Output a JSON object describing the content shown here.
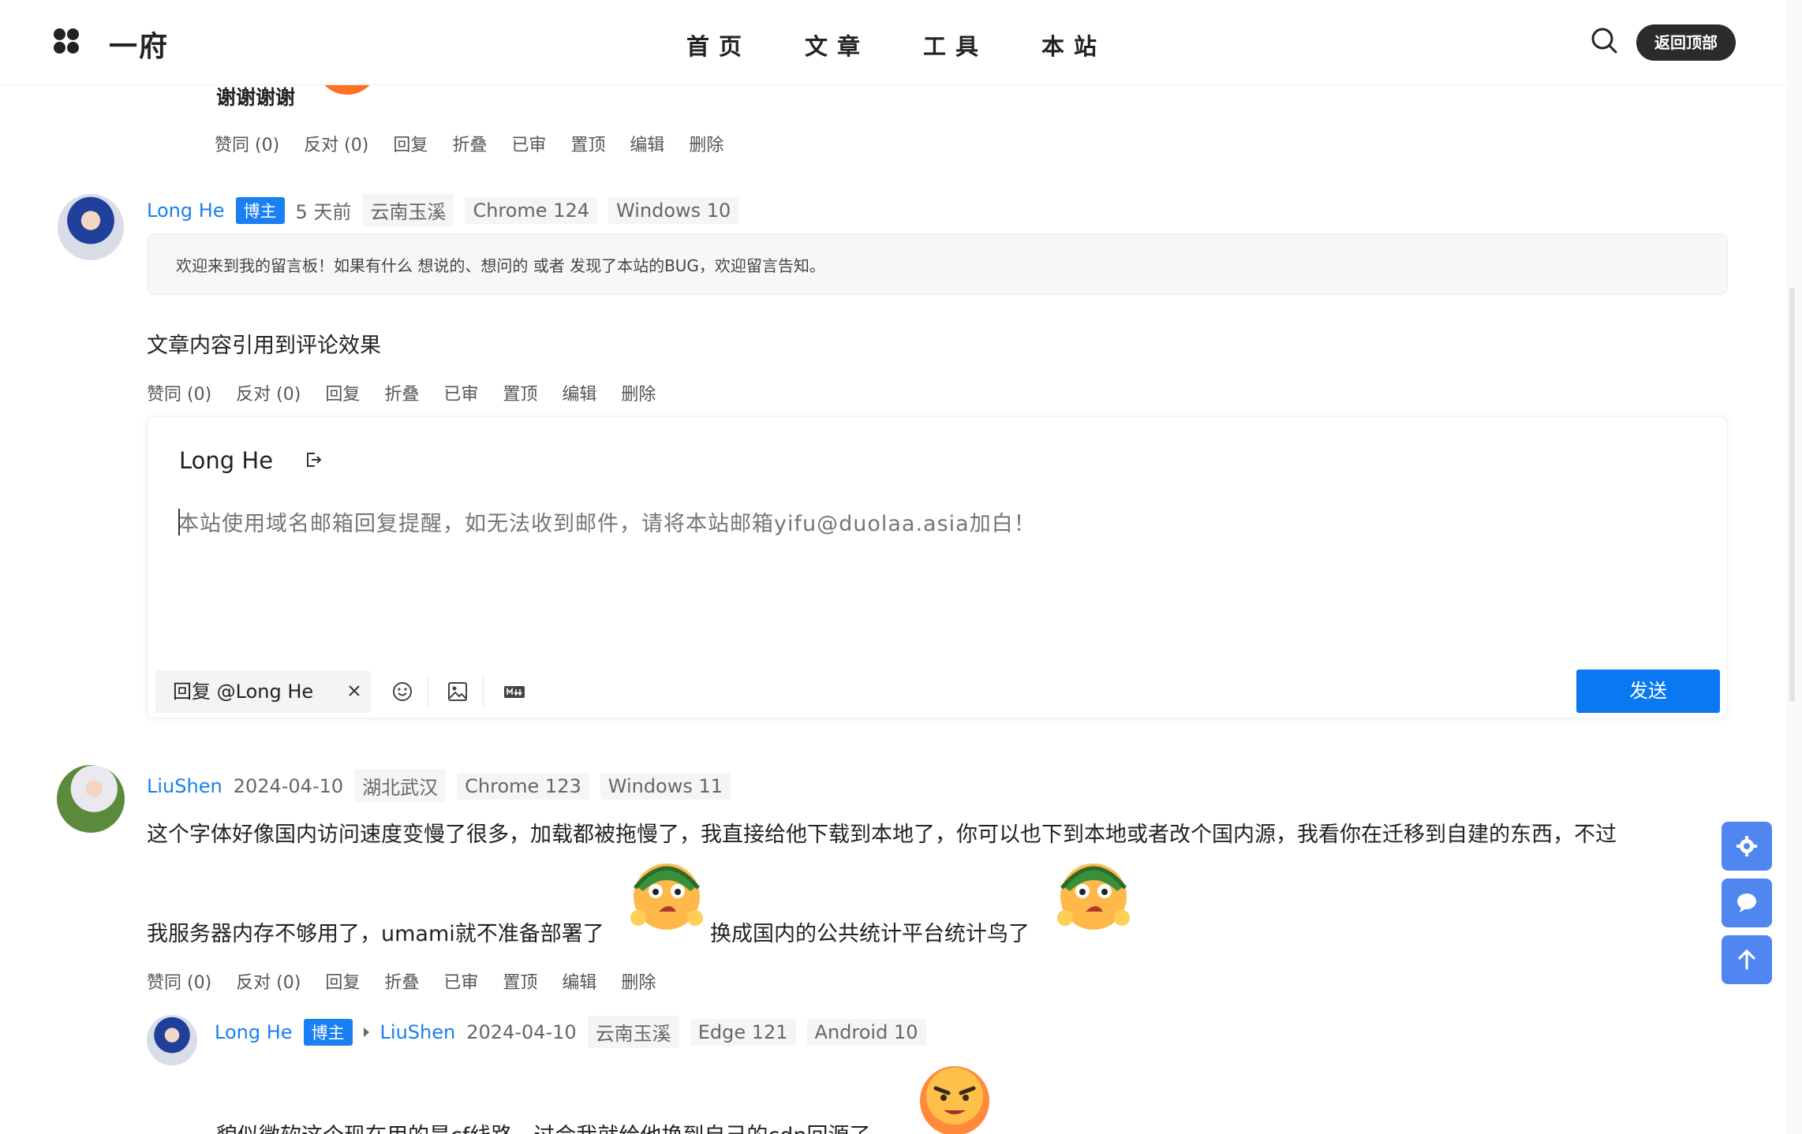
{
  "header": {
    "site_name": "一府",
    "nav": [
      "首页",
      "文章",
      "工具",
      "本站"
    ],
    "back_top_label": "返回顶部"
  },
  "comment0": {
    "text": "谢谢谢谢",
    "actions": [
      "赞同 (0)",
      "反对 (0)",
      "回复",
      "折叠",
      "已审",
      "置顶",
      "编辑",
      "删除"
    ]
  },
  "comment1": {
    "author": "Long He",
    "badge": "博主",
    "time": "5 天前",
    "location": "云南玉溪",
    "browser": "Chrome 124",
    "os": "Windows 10",
    "quote": "欢迎来到我的留言板！如果有什么 想说的、想问的 或者 发现了本站的BUG，欢迎留言告知。",
    "text": "文章内容引用到评论效果",
    "actions": [
      "赞同 (0)",
      "反对 (0)",
      "回复",
      "折叠",
      "已审",
      "置顶",
      "编辑",
      "删除"
    ]
  },
  "editor": {
    "user": "Long He",
    "placeholder": "本站使用域名邮箱回复提醒，如无法收到邮件，请将本站邮箱yifu@duolaa.asia加白！",
    "reply_to": "回复 @Long He",
    "send_label": "发送",
    "tools": [
      "smile-icon",
      "image-icon",
      "markdown-icon"
    ]
  },
  "comment2": {
    "author": "LiuShen",
    "date": "2024-04-10",
    "location": "湖北武汉",
    "browser": "Chrome 123",
    "os": "Windows 11",
    "line1": "这个字体好像国内访问速度变慢了很多，加载都被拖慢了，我直接给他下载到本地了，你可以也下到本地或者改个国内源，我看你在迁移到自建的东西，不过",
    "line2a": "我服务器内存不够用了，umami就不准备部署了",
    "line2b": "换成国内的公共统计平台统计鸟了",
    "actions": [
      "赞同 (0)",
      "反对 (0)",
      "回复",
      "折叠",
      "已审",
      "置顶",
      "编辑",
      "删除"
    ]
  },
  "reply1": {
    "author": "Long He",
    "badge": "博主",
    "reply_to": "LiuShen",
    "date": "2024-04-10",
    "location": "云南玉溪",
    "browser": "Edge 121",
    "os": "Android 10",
    "text": "貌似微软这个现在用的是cf线路，过会我就给他换到自己的cdn回源了"
  },
  "float_buttons": [
    "settings-icon",
    "chat-icon",
    "arrow-up-icon"
  ],
  "colors": {
    "accent": "#1a7ff0",
    "send": "#0a78f0",
    "float": "#4f86f0",
    "dark": "#2b2b2b"
  }
}
